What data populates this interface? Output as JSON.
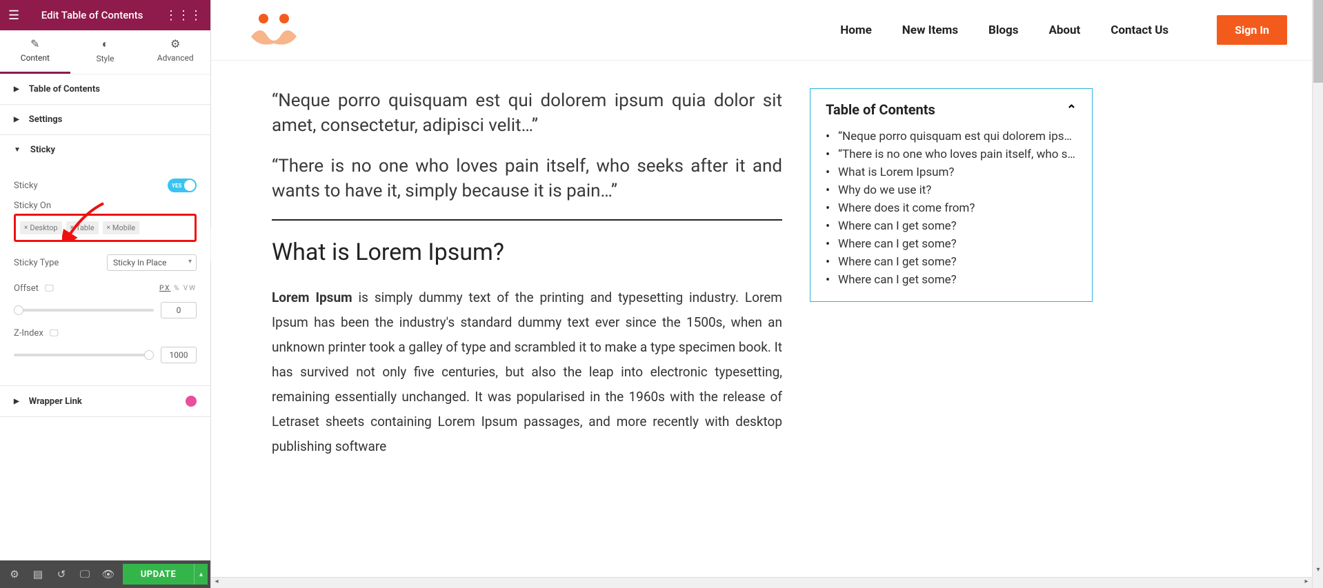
{
  "sidebar": {
    "title": "Edit Table of Contents",
    "tabs": {
      "content": "Content",
      "style": "Style",
      "advanced": "Advanced"
    },
    "sections": {
      "toc": "Table of Contents",
      "settings": "Settings",
      "sticky": "Sticky",
      "wrapper": "Wrapper Link"
    },
    "sticky": {
      "sticky_label": "Sticky",
      "toggle_text": "YES",
      "sticky_on_label": "Sticky On",
      "devices": [
        "Desktop",
        "Table",
        "Mobile"
      ],
      "sticky_type_label": "Sticky Type",
      "sticky_type_value": "Sticky In Place",
      "offset_label": "Offset",
      "offset_value": "0",
      "units": {
        "px": "PX",
        "pct": "%",
        "vw": "VW"
      },
      "zindex_label": "Z-Index",
      "zindex_value": "1000"
    },
    "footer": {
      "update": "UPDATE"
    }
  },
  "site": {
    "nav": [
      "Home",
      "New Items",
      "Blogs",
      "About",
      "Contact Us"
    ],
    "signin": "Sign In"
  },
  "article": {
    "quote1": "“Neque porro quisquam est qui dolorem ipsum quia dolor sit amet, consectetur, adipisci velit…”",
    "quote2": "“There is no one who loves pain itself, who seeks after it and wants to have it, simply because it is pain…”",
    "h2": "What is Lorem Ipsum?",
    "lead": "Lorem Ipsum",
    "body": " is simply dummy text of the printing and typesetting industry. Lorem Ipsum has been the industry's standard dummy text ever since the 1500s, when an unknown printer took a galley of type and scrambled it to make a type specimen book. It has survived not only five centuries, but also the leap into electronic typesetting, remaining essentially unchanged. It was popularised in the 1960s with the release of Letraset sheets containing Lorem Ipsum passages, and more recently with desktop publishing software"
  },
  "toc": {
    "title": "Table of Contents",
    "items": [
      "“Neque porro quisquam est qui dolorem ipsu…",
      "“There is no one who loves pain itself, who see…",
      "What is Lorem Ipsum?",
      "Why do we use it?",
      "Where does it come from?",
      "Where can I get some?",
      "Where can I get some?",
      "Where can I get some?",
      "Where can I get some?"
    ]
  }
}
